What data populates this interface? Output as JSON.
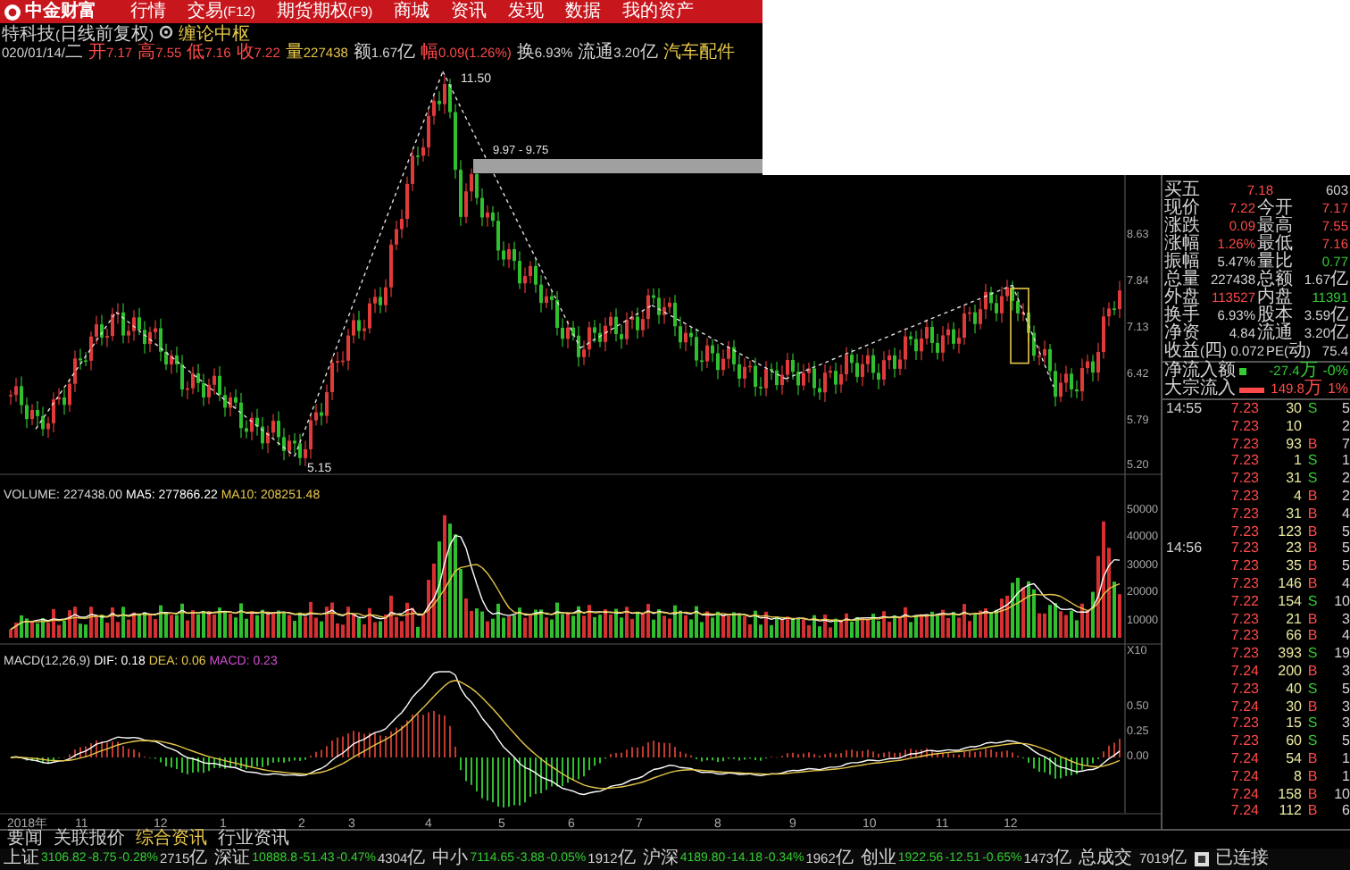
{
  "menu_bar": {
    "logo": "中金财富",
    "items": [
      {
        "label": "行情"
      },
      {
        "label": "交易(F12)"
      },
      {
        "label": "期货期权(F9)"
      },
      {
        "label": "商城"
      },
      {
        "label": "资讯"
      },
      {
        "label": "发现"
      },
      {
        "label": "数据"
      },
      {
        "label": "我的资产"
      }
    ]
  },
  "stock_header": {
    "name": "特科技(日线前复权)",
    "indicator": "缠论中枢",
    "quote": [
      {
        "text": "020/01/14/二",
        "kind": "plain"
      },
      {
        "text": "开7.17",
        "kind": "up"
      },
      {
        "text": "高7.55",
        "kind": "up"
      },
      {
        "text": "低7.16",
        "kind": "up"
      },
      {
        "text": "收7.22",
        "kind": "up"
      },
      {
        "text": "量227438",
        "kind": "accent"
      },
      {
        "text": "额1.67亿",
        "kind": "plain"
      },
      {
        "text": "幅0.09(1.26%)",
        "kind": "up"
      },
      {
        "text": "换6.93%",
        "kind": "plain"
      },
      {
        "text": "流通3.20亿",
        "kind": "plain"
      },
      {
        "text": "汽车配件",
        "kind": "accent"
      }
    ]
  },
  "main_chart": {
    "high_label": "11.50",
    "low_label": "5.15",
    "range_label": "9.97 - 9.75",
    "axis_labels": [
      "8.63",
      "7.84",
      "7.13",
      "6.42",
      "5.79",
      "5.20"
    ]
  },
  "volume_panel": {
    "legend": [
      {
        "text": "VOLUME: 227438.00",
        "kind": "volume"
      },
      {
        "text": "MA5: 277866.22",
        "kind": "ma5"
      },
      {
        "text": "MA10: 208251.48",
        "kind": "ma10"
      }
    ],
    "axis_labels": [
      "50000",
      "40000",
      "30000",
      "20000",
      "10000",
      "X10"
    ]
  },
  "macd_panel": {
    "legend": [
      {
        "text": "MACD(12,26,9)",
        "kind": "title"
      },
      {
        "text": "DIF: 0.18",
        "kind": "dif"
      },
      {
        "text": "DEA: 0.06",
        "kind": "dea"
      },
      {
        "text": "MACD: 0.23",
        "kind": "macd"
      }
    ],
    "axis_labels": [
      "0.50",
      "0.25",
      "0.00"
    ]
  },
  "x_axis": [
    "2018年",
    "11",
    "12",
    "1",
    "2",
    "3",
    "4",
    "5",
    "6",
    "7",
    "8",
    "9",
    "10",
    "11",
    "12"
  ],
  "news_tabs": [
    {
      "label": "要闻",
      "selected": false
    },
    {
      "label": "关联报价",
      "selected": false
    },
    {
      "label": "综合资讯",
      "selected": true
    },
    {
      "label": "行业资讯",
      "selected": false
    }
  ],
  "quote_panel": {
    "rows": [
      {
        "cells": [
          {
            "label": "买五",
            "value": "7.18",
            "kind": "up"
          },
          {
            "value": "603",
            "kind": "plain"
          }
        ]
      },
      {
        "cells": [
          {
            "label": "现价",
            "value": "7.22",
            "kind": "up"
          },
          {
            "label": "今开",
            "value": "7.17",
            "kind": "up"
          }
        ]
      },
      {
        "cells": [
          {
            "label": "涨跌",
            "value": "0.09",
            "kind": "up"
          },
          {
            "label": "最高",
            "value": "7.55",
            "kind": "up"
          }
        ]
      },
      {
        "cells": [
          {
            "label": "涨幅",
            "value": "1.26%",
            "kind": "up"
          },
          {
            "label": "最低",
            "value": "7.16",
            "kind": "up"
          }
        ]
      },
      {
        "cells": [
          {
            "label": "振幅",
            "value": "5.47%",
            "kind": "plain"
          },
          {
            "label": "量比",
            "value": "0.77",
            "kind": "down"
          }
        ]
      },
      {
        "cells": [
          {
            "label": "总量",
            "value": "227438",
            "kind": "plain"
          },
          {
            "label": "总额",
            "value": "1.67亿",
            "kind": "plain"
          }
        ]
      },
      {
        "cells": [
          {
            "label": "外盘",
            "value": "113527",
            "kind": "up"
          },
          {
            "label": "内盘",
            "value": "11391",
            "kind": "down"
          }
        ]
      },
      {
        "cells": [
          {
            "label": "换手",
            "value": "6.93%",
            "kind": "plain"
          },
          {
            "label": "股本",
            "value": "3.59亿",
            "kind": "plain"
          }
        ]
      },
      {
        "cells": [
          {
            "label": "净资",
            "value": "4.84",
            "kind": "plain"
          },
          {
            "label": "流通",
            "value": "3.20亿",
            "kind": "plain"
          }
        ]
      },
      {
        "cells": [
          {
            "label": "收益(四)",
            "value": "0.072",
            "kind": "plain"
          },
          {
            "label": "PE(动)",
            "value": "75.4",
            "kind": "plain"
          }
        ]
      }
    ],
    "flows": [
      {
        "label": "净流入额",
        "kind": "down",
        "amount": "-27.4万",
        "percent": "-0%"
      },
      {
        "label": "大宗流入",
        "kind": "up",
        "amount": "149.8万",
        "percent": "1%"
      }
    ],
    "ticks": [
      {
        "time": "14:55",
        "price": "7.23",
        "volume": "30",
        "side": "S",
        "kind": "sell",
        "rest": "5"
      },
      {
        "price": "7.23",
        "volume": "10",
        "kind": "none",
        "rest": "2"
      },
      {
        "price": "7.23",
        "volume": "93",
        "side": "B",
        "kind": "buy",
        "rest": "7"
      },
      {
        "price": "7.23",
        "volume": "1",
        "side": "S",
        "kind": "sell",
        "rest": "1"
      },
      {
        "price": "7.23",
        "volume": "31",
        "side": "S",
        "kind": "sell",
        "rest": "2"
      },
      {
        "price": "7.23",
        "volume": "4",
        "side": "B",
        "kind": "buy",
        "rest": "2"
      },
      {
        "price": "7.23",
        "volume": "31",
        "side": "B",
        "kind": "buy",
        "rest": "4"
      },
      {
        "price": "7.23",
        "volume": "123",
        "side": "B",
        "kind": "buy",
        "rest": "5"
      },
      {
        "time": "14:56",
        "price": "7.23",
        "volume": "23",
        "side": "B",
        "kind": "buy",
        "rest": "5"
      },
      {
        "price": "7.23",
        "volume": "35",
        "side": "B",
        "kind": "buy",
        "rest": "5"
      },
      {
        "price": "7.23",
        "volume": "146",
        "side": "B",
        "kind": "buy",
        "rest": "4"
      },
      {
        "price": "7.22",
        "volume": "154",
        "side": "S",
        "kind": "sell",
        "rest": "10"
      },
      {
        "price": "7.23",
        "volume": "21",
        "side": "B",
        "kind": "buy",
        "rest": "3"
      },
      {
        "price": "7.23",
        "volume": "66",
        "side": "B",
        "kind": "buy",
        "rest": "4"
      },
      {
        "price": "7.23",
        "volume": "393",
        "side": "S",
        "kind": "sell",
        "rest": "19"
      },
      {
        "price": "7.24",
        "volume": "200",
        "side": "B",
        "kind": "buy",
        "rest": "3"
      },
      {
        "price": "7.23",
        "volume": "40",
        "side": "S",
        "kind": "sell",
        "rest": "5"
      },
      {
        "price": "7.24",
        "volume": "30",
        "side": "B",
        "kind": "buy",
        "rest": "3"
      },
      {
        "price": "7.23",
        "volume": "15",
        "side": "S",
        "kind": "sell",
        "rest": "3"
      },
      {
        "price": "7.23",
        "volume": "60",
        "side": "S",
        "kind": "sell",
        "rest": "5"
      },
      {
        "price": "7.24",
        "volume": "54",
        "side": "B",
        "kind": "buy",
        "rest": "1"
      },
      {
        "price": "7.24",
        "volume": "8",
        "side": "B",
        "kind": "buy",
        "rest": "1"
      },
      {
        "price": "7.24",
        "volume": "158",
        "side": "B",
        "kind": "buy",
        "rest": "10"
      },
      {
        "price": "7.24",
        "volume": "112",
        "side": "B",
        "kind": "buy",
        "rest": "6"
      }
    ]
  },
  "status_bar": {
    "indices": [
      {
        "name": "上证",
        "value": "3106.82",
        "change": "-8.75",
        "percent": "-0.28%",
        "amount": "2715亿"
      },
      {
        "name": "深证",
        "value": "10888.8",
        "change": "-51.43",
        "percent": "-0.47%",
        "amount": "4304亿"
      },
      {
        "name": "中小",
        "value": "7114.65",
        "change": "-3.88",
        "percent": "-0.05%",
        "amount": "1912亿"
      },
      {
        "name": "沪深",
        "value": "4189.80",
        "change": "-14.18",
        "percent": "-0.34%",
        "amount": "1962亿"
      },
      {
        "name": "创业",
        "value": "1922.56",
        "change": "-12.51",
        "percent": "-0.65%",
        "amount": "1473亿"
      }
    ],
    "total_label": "总成交",
    "total": "7019亿",
    "connection": "已连接"
  }
}
